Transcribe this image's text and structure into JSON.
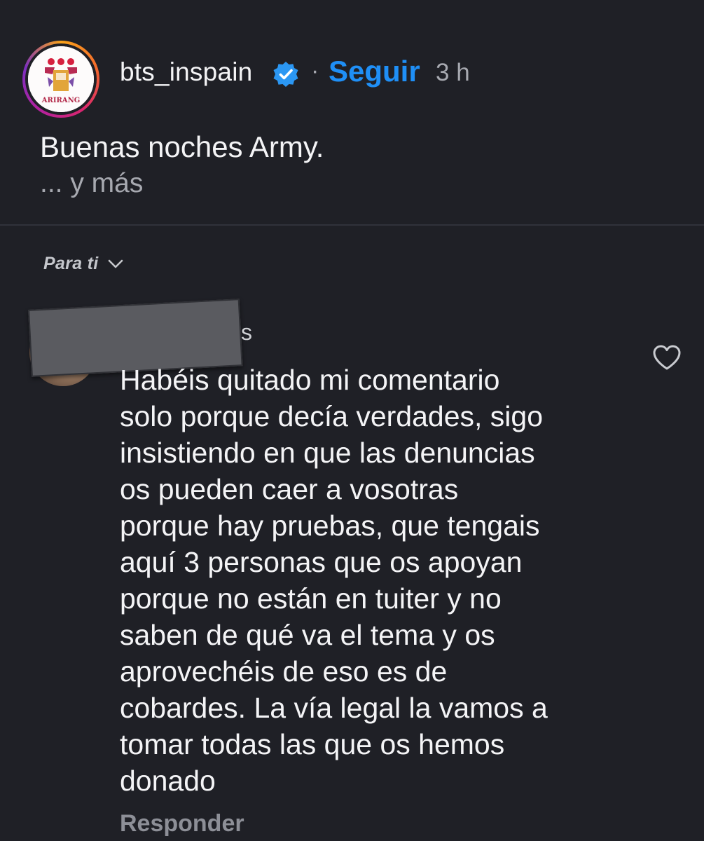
{
  "post": {
    "username": "bts_inspain",
    "separator": "·",
    "follow_label": "Seguir",
    "time": "3 h",
    "caption": "Buenas noches Army.",
    "more_label": "... y más",
    "avatar_badge_text": "ARIRANG"
  },
  "comments_sort": {
    "label": "Para ti"
  },
  "comment": {
    "username_visible_tail": "s",
    "text": "Habéis quitado mi comentario\nsolo porque decía verdades, sigo\ninsistiendo en que las denuncias\nos pueden caer a vosotras\nporque hay pruebas, que tengais\naquí 3 personas que os apoyan\nporque no están en tuiter y no\nsaben de qué va el tema y os\naprovechéis de eso es de\ncobardes. La vía legal la vamos a\ntomar todas las que os hemos\ndonado",
    "reply_label": "Responder"
  },
  "icons": {
    "verified": "verified-badge-icon",
    "sort_chevron": "chevron-down-icon",
    "like": "heart-icon"
  },
  "colors": {
    "background": "#1f2026",
    "accent_blue": "#1f8ff6",
    "muted_text": "#a7a9b0"
  }
}
